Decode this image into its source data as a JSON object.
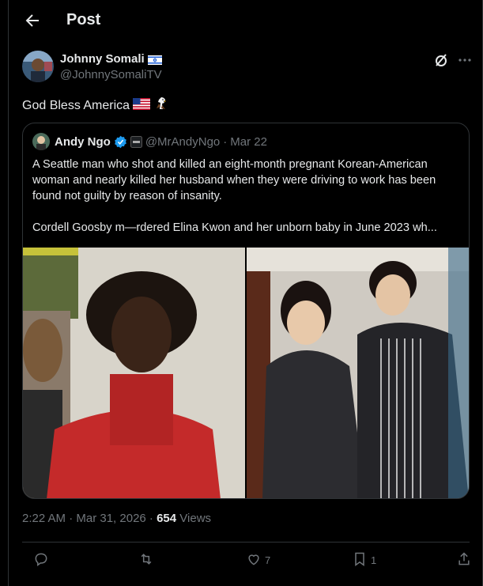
{
  "header": {
    "title": "Post"
  },
  "post": {
    "author_name": "Johnny Somali",
    "author_handle": "@JohnnySomaliTV",
    "text": "God Bless America",
    "timestamp": "2:22 AM · Mar 31, 2026 · ",
    "views_count": "654",
    "views_label": " Views"
  },
  "quote": {
    "author_name": "Andy Ngo",
    "handle": "@MrAndyNgo",
    "dot": "·",
    "date": "Mar 22",
    "paragraph1": "A Seattle man who shot and killed an eight-month pregnant Korean-American woman and nearly killed her husband when they were driving to work has been found not guilty by reason of insanity.",
    "paragraph2": "Cordell Goosby m—rdered Elina Kwon and her unborn baby in June 2023 wh..."
  },
  "actions": {
    "reply_count": "",
    "repost_count": "",
    "like_count": "7",
    "bookmark_count": "1"
  },
  "icons": [
    "back-arrow-icon",
    "grok-icon",
    "more-icon",
    "flag-israel-icon",
    "flag-usa-icon",
    "eagle-icon",
    "verified-icon",
    "org-badge-icon",
    "reply-icon",
    "repost-icon",
    "like-icon",
    "bookmark-icon",
    "share-icon"
  ],
  "colors": {
    "background": "#000000",
    "text": "#e7e9ea",
    "muted": "#71767b",
    "border": "#2f3336",
    "verified": "#1d9bf0"
  }
}
